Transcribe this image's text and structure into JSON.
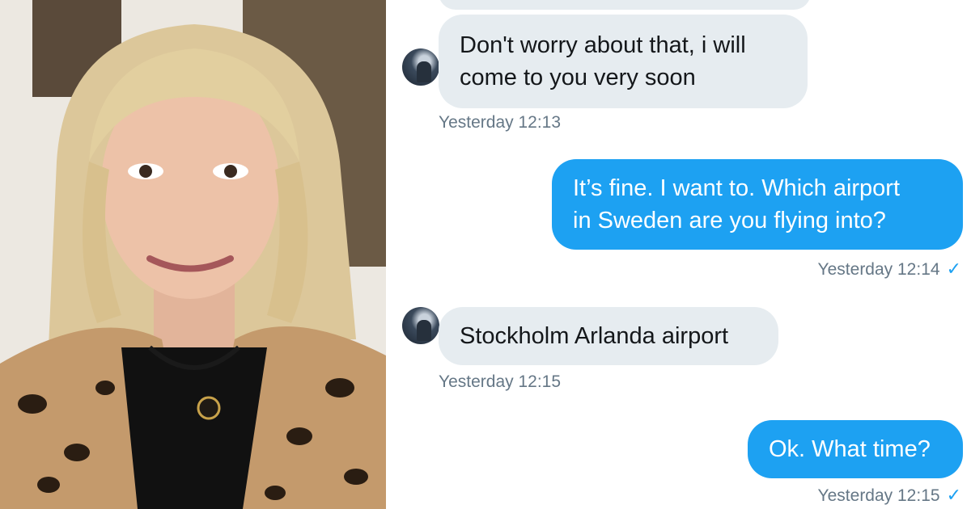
{
  "chat": {
    "messages": [
      {
        "direction": "incoming",
        "lines": [
          "Don't worry about that, i will",
          "come to you very soon"
        ],
        "timestamp": "Yesterday 12:13"
      },
      {
        "direction": "outgoing",
        "lines": [
          "It’s fine. I want to. Which airport",
          "in Sweden are you flying into?"
        ],
        "timestamp": "Yesterday 12:14",
        "read_mark": "✓"
      },
      {
        "direction": "incoming",
        "lines": [
          "Stockholm Arlanda airport"
        ],
        "timestamp": "Yesterday 12:15"
      },
      {
        "direction": "outgoing",
        "lines": [
          "Ok. What time?"
        ],
        "timestamp": "Yesterday 12:15",
        "read_mark": "✓"
      }
    ]
  },
  "colors": {
    "outgoing_bubble": "#1da1f2",
    "incoming_bubble": "#e6ecf0",
    "timestamp_text": "#657786"
  },
  "icons": [
    "avatar",
    "check-icon"
  ]
}
